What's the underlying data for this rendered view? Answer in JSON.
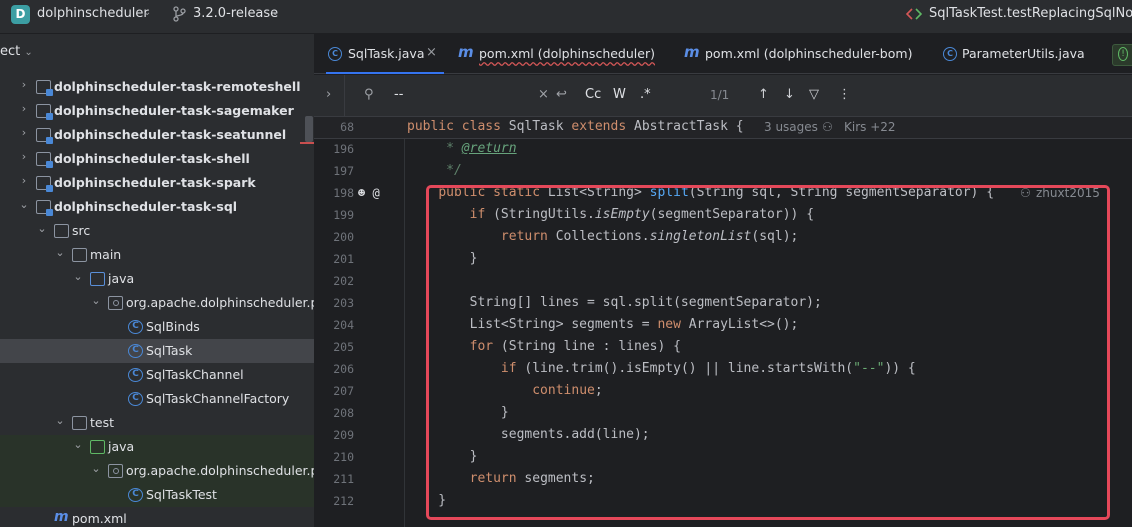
{
  "titlebar": {
    "project_badge": "D",
    "project_name": "dolphinscheduler",
    "branch": "3.2.0-release",
    "run_config": "SqlTaskTest.testReplacingSqlNonG"
  },
  "project_panel": {
    "header": "ect",
    "tree": [
      {
        "label": "dolphinscheduler-task-remoteshell",
        "icon": "module-icon",
        "arrow": ">",
        "bold": true
      },
      {
        "label": "dolphinscheduler-task-sagemaker",
        "icon": "module-icon",
        "arrow": ">",
        "bold": true
      },
      {
        "label": "dolphinscheduler-task-seatunnel",
        "icon": "module-icon",
        "arrow": ">",
        "bold": true
      },
      {
        "label": "dolphinscheduler-task-shell",
        "icon": "module-icon",
        "arrow": ">",
        "bold": true
      },
      {
        "label": "dolphinscheduler-task-spark",
        "icon": "module-icon",
        "arrow": ">",
        "bold": true
      },
      {
        "label": "dolphinscheduler-task-sql",
        "icon": "module-icon",
        "arrow": "v",
        "bold": true
      },
      {
        "label": "src",
        "icon": "folder-icon",
        "arrow": "v"
      },
      {
        "label": "main",
        "icon": "folder-icon",
        "arrow": "v"
      },
      {
        "label": "java",
        "icon": "source-folder-icon",
        "arrow": "v"
      },
      {
        "label": "org.apache.dolphinscheduler.pl",
        "icon": "package-icon",
        "arrow": "v"
      },
      {
        "label": "SqlBinds",
        "icon": "class-icon"
      },
      {
        "label": "SqlTask",
        "icon": "class-icon",
        "selected": true
      },
      {
        "label": "SqlTaskChannel",
        "icon": "class-icon"
      },
      {
        "label": "SqlTaskChannelFactory",
        "icon": "class-icon"
      },
      {
        "label": "test",
        "icon": "folder-icon",
        "arrow": "v"
      },
      {
        "label": "java",
        "icon": "test-folder-icon",
        "arrow": "v",
        "green": true
      },
      {
        "label": "org.apache.dolphinscheduler.pl",
        "icon": "package-icon",
        "arrow": "v",
        "green": true
      },
      {
        "label": "SqlTaskTest",
        "icon": "test-class-icon",
        "green": true
      },
      {
        "label": "pom.xml",
        "icon": "maven-icon"
      }
    ]
  },
  "tabs": [
    {
      "label": "SqlTask.java",
      "icon": "class-icon",
      "active": true
    },
    {
      "label": "pom.xml (dolphinscheduler)",
      "icon": "maven-icon"
    },
    {
      "label": "pom.xml (dolphinscheduler-bom)",
      "icon": "maven-icon"
    },
    {
      "label": "ParameterUtils.java",
      "icon": "class-icon"
    }
  ],
  "findbar": {
    "query": "--",
    "match_case": "Cc",
    "words": "W",
    "regex": ".*",
    "count": "1/1"
  },
  "sticky": {
    "line": "68",
    "code": "public class SqlTask extends AbstractTask {",
    "usages": "3 usages",
    "author": "Kirs +22"
  },
  "code_lines": [
    {
      "n": "196",
      "code": "     * @return"
    },
    {
      "n": "197",
      "code": "     */"
    },
    {
      "n": "198",
      "code": "    public static List<String> split(String sql, String segmentSeparator) {",
      "author": "zhuxt2015"
    },
    {
      "n": "199",
      "code": "        if (StringUtils.isEmpty(segmentSeparator)) {"
    },
    {
      "n": "200",
      "code": "            return Collections.singletonList(sql);"
    },
    {
      "n": "201",
      "code": "        }"
    },
    {
      "n": "202",
      "code": ""
    },
    {
      "n": "203",
      "code": "        String[] lines = sql.split(segmentSeparator);"
    },
    {
      "n": "204",
      "code": "        List<String> segments = new ArrayList<>();"
    },
    {
      "n": "205",
      "code": "        for (String line : lines) {"
    },
    {
      "n": "206",
      "code": "            if (line.trim().isEmpty() || line.startsWith(\"--\")) {"
    },
    {
      "n": "207",
      "code": "                continue;"
    },
    {
      "n": "208",
      "code": "            }"
    },
    {
      "n": "209",
      "code": "            segments.add(line);"
    },
    {
      "n": "210",
      "code": "        }"
    },
    {
      "n": "211",
      "code": "        return segments;"
    },
    {
      "n": "212",
      "code": "    }"
    }
  ],
  "colors": {
    "accent": "#3574f0",
    "highlight_box": "#e5485a",
    "keyword": "#cf8e6d",
    "function": "#56a8f5",
    "string": "#6aab73"
  }
}
